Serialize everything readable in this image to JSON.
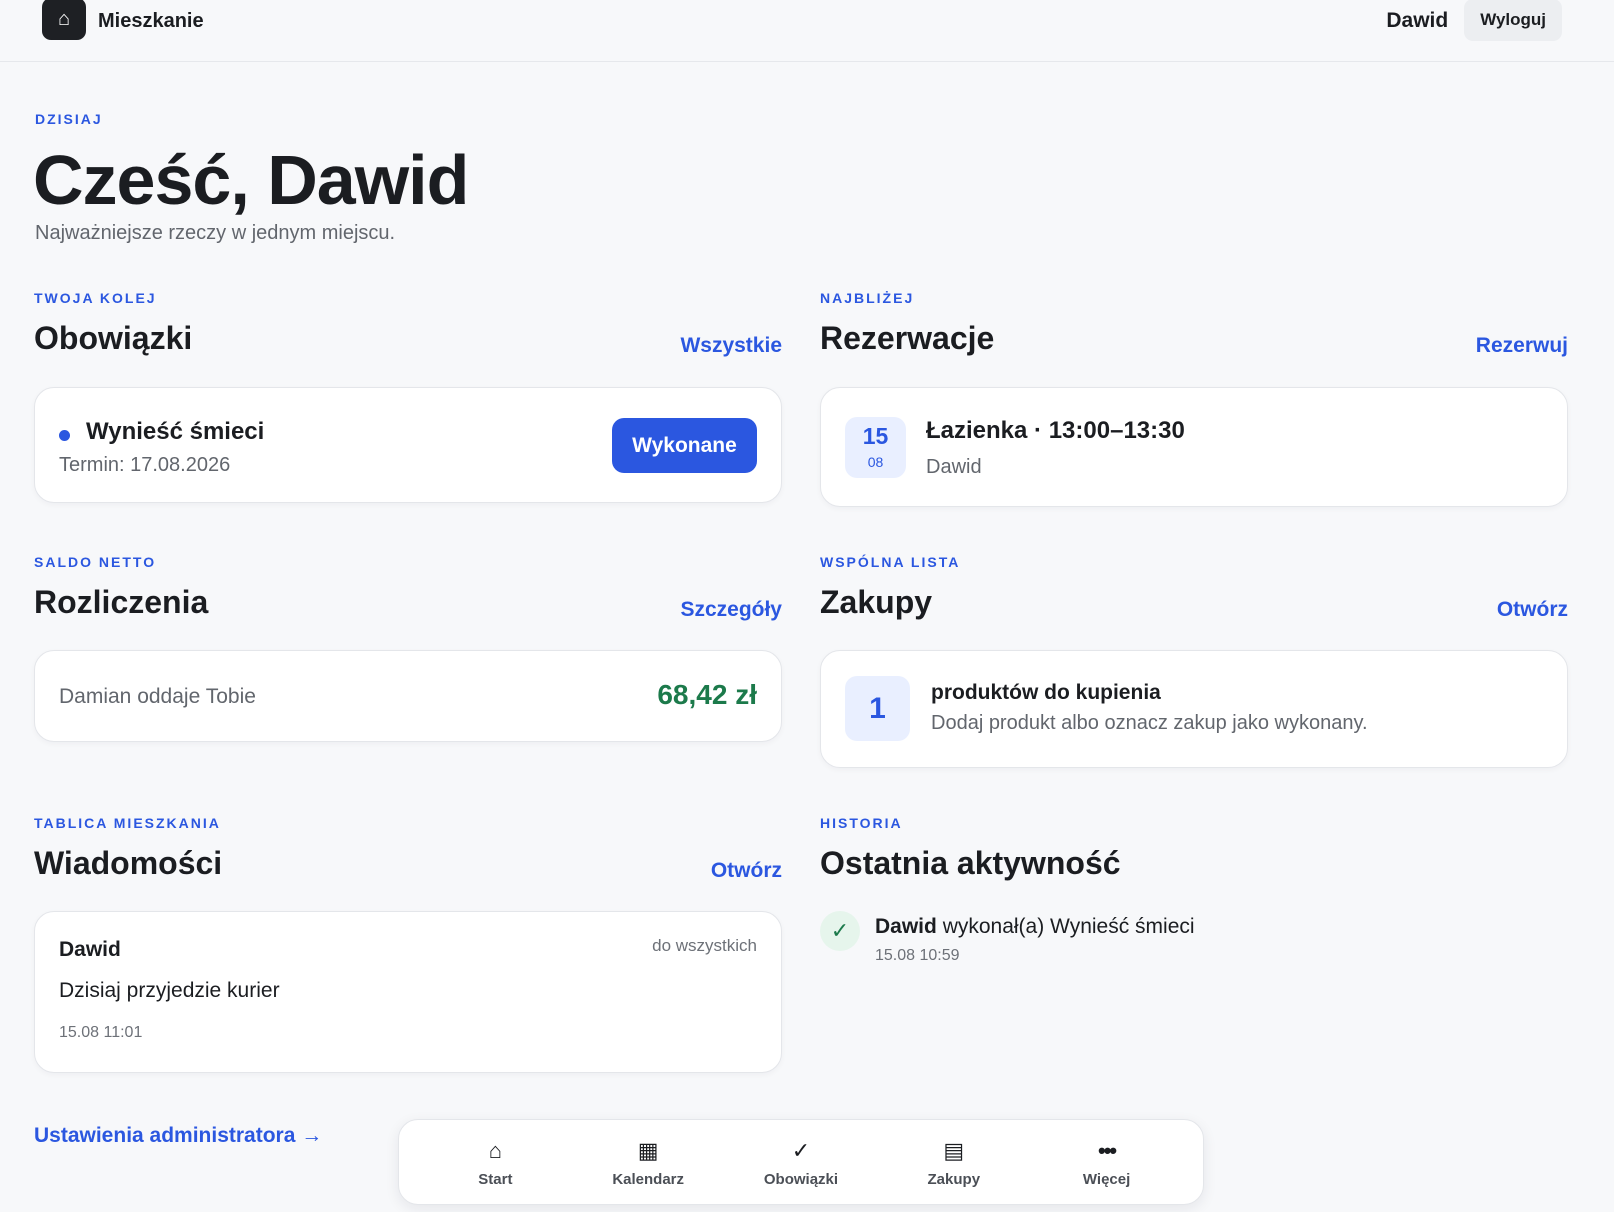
{
  "header": {
    "brand_icon": "⌂",
    "brand_name": "Mieszkanie",
    "user_name": "Dawid",
    "logout_label": "Wyloguj"
  },
  "hero": {
    "eyebrow": "DZISIAJ",
    "title": "Cześć, Dawid",
    "subtitle": "Najważniejsze rzeczy w jednym miejscu."
  },
  "chores": {
    "eyebrow": "TWOJA KOLEJ",
    "title": "Obowiązki",
    "link": "Wszystkie",
    "item": {
      "name": "Wynieść śmieci",
      "due": "Termin: 17.08.2026",
      "button": "Wykonane"
    }
  },
  "reservations": {
    "eyebrow": "NAJBLIŻEJ",
    "title": "Rezerwacje",
    "link": "Rezerwuj",
    "item": {
      "day": "15",
      "month": "08",
      "title": "Łazienka · 13:00–13:30",
      "user": "Dawid"
    }
  },
  "settlements": {
    "eyebrow": "SALDO NETTO",
    "title": "Rozliczenia",
    "link": "Szczegóły",
    "text": "Damian oddaje Tobie",
    "amount": "68,42 zł",
    "amount_color": "#1c7a4b"
  },
  "shopping": {
    "eyebrow": "WSPÓLNA LISTA",
    "title": "Zakupy",
    "link": "Otwórz",
    "count": "1",
    "count_label": "produktów do kupienia",
    "hint": "Dodaj produkt albo oznacz zakup jako wykonany."
  },
  "messages": {
    "eyebrow": "TABLICA MIESZKANIA",
    "title": "Wiadomości",
    "link": "Otwórz",
    "item": {
      "author": "Dawid",
      "target": "do wszystkich",
      "body": "Dzisiaj przyjedzie kurier",
      "time": "15.08 11:01"
    }
  },
  "history": {
    "eyebrow": "HISTORIA",
    "title": "Ostatnia aktywność",
    "item": {
      "check_icon": "✓",
      "user": "Dawid",
      "action": "wykonał(a) Wynieść śmieci",
      "time": "15.08 10:59"
    }
  },
  "admin_link": "Ustawienia administratora →",
  "nav": [
    {
      "icon": "⌂",
      "label": "Start"
    },
    {
      "icon": "▦",
      "label": "Kalendarz"
    },
    {
      "icon": "✓",
      "label": "Obowiązki"
    },
    {
      "icon": "▤",
      "label": "Zakupy"
    },
    {
      "icon": "•••",
      "label": "Więcej"
    }
  ],
  "colors": {
    "accent": "#2b57e0",
    "positive": "#1c7a4b",
    "background": "#f7f8fa"
  }
}
